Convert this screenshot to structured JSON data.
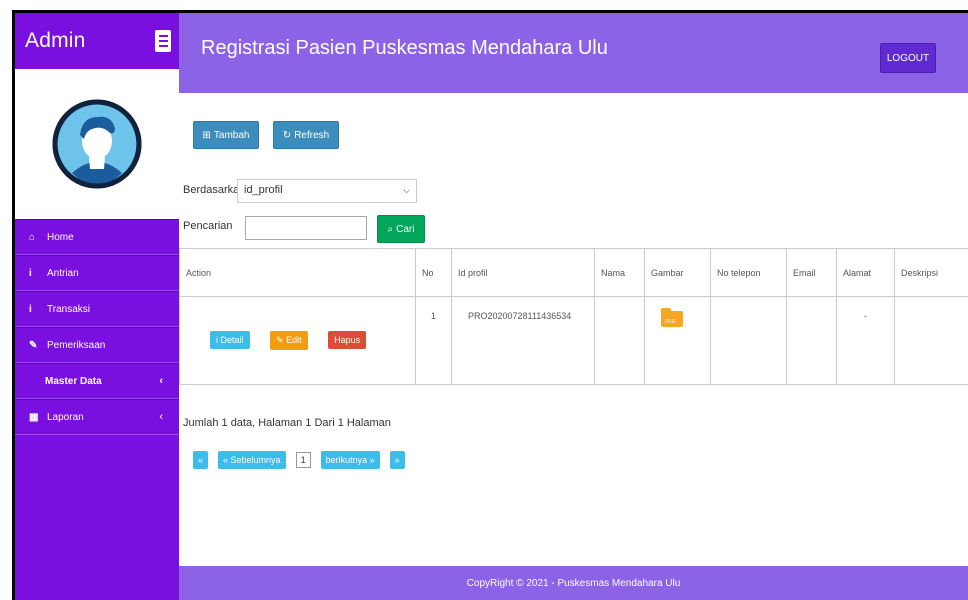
{
  "sidebar": {
    "brand": "Admin",
    "items": [
      {
        "label": "Home",
        "icon": "⌂"
      },
      {
        "label": "Antrian",
        "icon": "i"
      },
      {
        "label": "Transaksi",
        "icon": "i"
      },
      {
        "label": "Pemeriksaan",
        "icon": "✎"
      },
      {
        "label": "Master Data",
        "icon": ""
      },
      {
        "label": "Laporan",
        "icon": "▦"
      }
    ],
    "chevron": "‹"
  },
  "header": {
    "title": "Registrasi Pasien Puskesmas Mendahara Ulu",
    "logout": "LOGOUT"
  },
  "toolbar": {
    "tambah": "Tambah",
    "refresh": "Refresh",
    "filter_label": "Berdasarkan:",
    "filter_value": "id_profil",
    "search_label": "Pencarian",
    "search_button": "Cari"
  },
  "table": {
    "headers": [
      "Action",
      "No",
      "Id profil",
      "Nama",
      "Gambar",
      "No telepon",
      "Email",
      "Alamat",
      "Deskripsi"
    ],
    "rows": [
      {
        "no": "1",
        "id_profil": "PRO20200728111436534",
        "nama": "",
        "gambar": "FILE",
        "no_telepon": "",
        "email": "",
        "alamat": "-",
        "deskripsi": ""
      }
    ],
    "actions": {
      "detail": "Detail",
      "edit": "Edit",
      "hapus": "Hapus"
    }
  },
  "summary": "Jumlah 1 data, Halaman 1 Dari 1 Halaman",
  "pager": {
    "first": "«",
    "prev": "« Sebelumnya",
    "current": "1",
    "next": "berikutnya »",
    "last": "»"
  },
  "footer": "CopyRight © 2021 - Puskesmas Mendahara Ulu",
  "colors": {
    "sidebar": "#7a10e0",
    "header": "#8c63e6",
    "primary": "#3c8dbc",
    "success": "#00a65a"
  }
}
